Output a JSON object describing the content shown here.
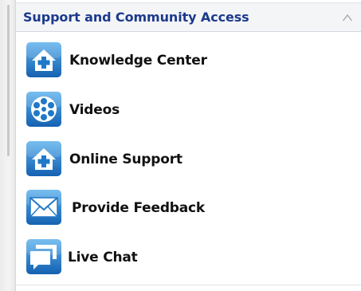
{
  "panel": {
    "title": "Support and Community Access",
    "collapse_icon": "chevron-up-icon",
    "items": [
      {
        "label": "Knowledge Center",
        "icon": "house-plus-icon"
      },
      {
        "label": "Videos",
        "icon": "film-reel-icon"
      },
      {
        "label": "Online Support",
        "icon": "house-plus-icon"
      },
      {
        "label": "Provide Feedback",
        "icon": "envelope-icon"
      },
      {
        "label": "Live Chat",
        "icon": "chat-bubbles-icon"
      }
    ]
  },
  "colors": {
    "title": "#1c3a8c",
    "icon_blue": "#1f78c8",
    "header_bg": "#f4f5f7"
  }
}
